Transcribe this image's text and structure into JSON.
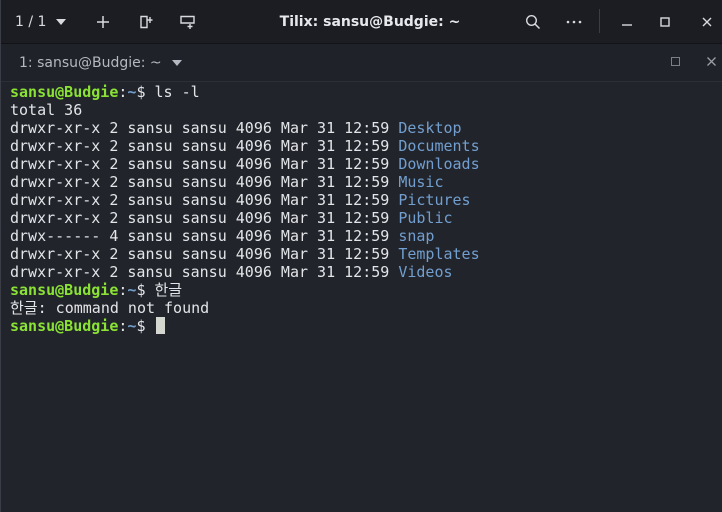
{
  "window": {
    "title": "Tilix: sansu@Budgie: ~",
    "session_counter": "1 / 1"
  },
  "terminal_tab": {
    "title": "1: sansu@Budgie: ~"
  },
  "colors": {
    "prompt_user": "#8ae234",
    "prompt_path": "#729fcf",
    "directory": "#729fcf",
    "background": "#21242b",
    "text": "#e3e5e8"
  },
  "prompt": {
    "user_host": "sansu@Budgie",
    "colon": ":",
    "path": "~",
    "symbol": "$"
  },
  "session": {
    "command1": " ls -l",
    "total": "total 36",
    "listing": [
      {
        "meta": "drwxr-xr-x 2 sansu sansu 4096 Mar 31 12:59 ",
        "name": "Desktop"
      },
      {
        "meta": "drwxr-xr-x 2 sansu sansu 4096 Mar 31 12:59 ",
        "name": "Documents"
      },
      {
        "meta": "drwxr-xr-x 2 sansu sansu 4096 Mar 31 12:59 ",
        "name": "Downloads"
      },
      {
        "meta": "drwxr-xr-x 2 sansu sansu 4096 Mar 31 12:59 ",
        "name": "Music"
      },
      {
        "meta": "drwxr-xr-x 2 sansu sansu 4096 Mar 31 12:59 ",
        "name": "Pictures"
      },
      {
        "meta": "drwxr-xr-x 2 sansu sansu 4096 Mar 31 12:59 ",
        "name": "Public"
      },
      {
        "meta": "drwx------ 4 sansu sansu 4096 Mar 31 12:59 ",
        "name": "snap"
      },
      {
        "meta": "drwxr-xr-x 2 sansu sansu 4096 Mar 31 12:59 ",
        "name": "Templates"
      },
      {
        "meta": "drwxr-xr-x 2 sansu sansu 4096 Mar 31 12:59 ",
        "name": "Videos"
      }
    ],
    "command2": " 한글",
    "error": "한글: command not found",
    "command3": " "
  }
}
